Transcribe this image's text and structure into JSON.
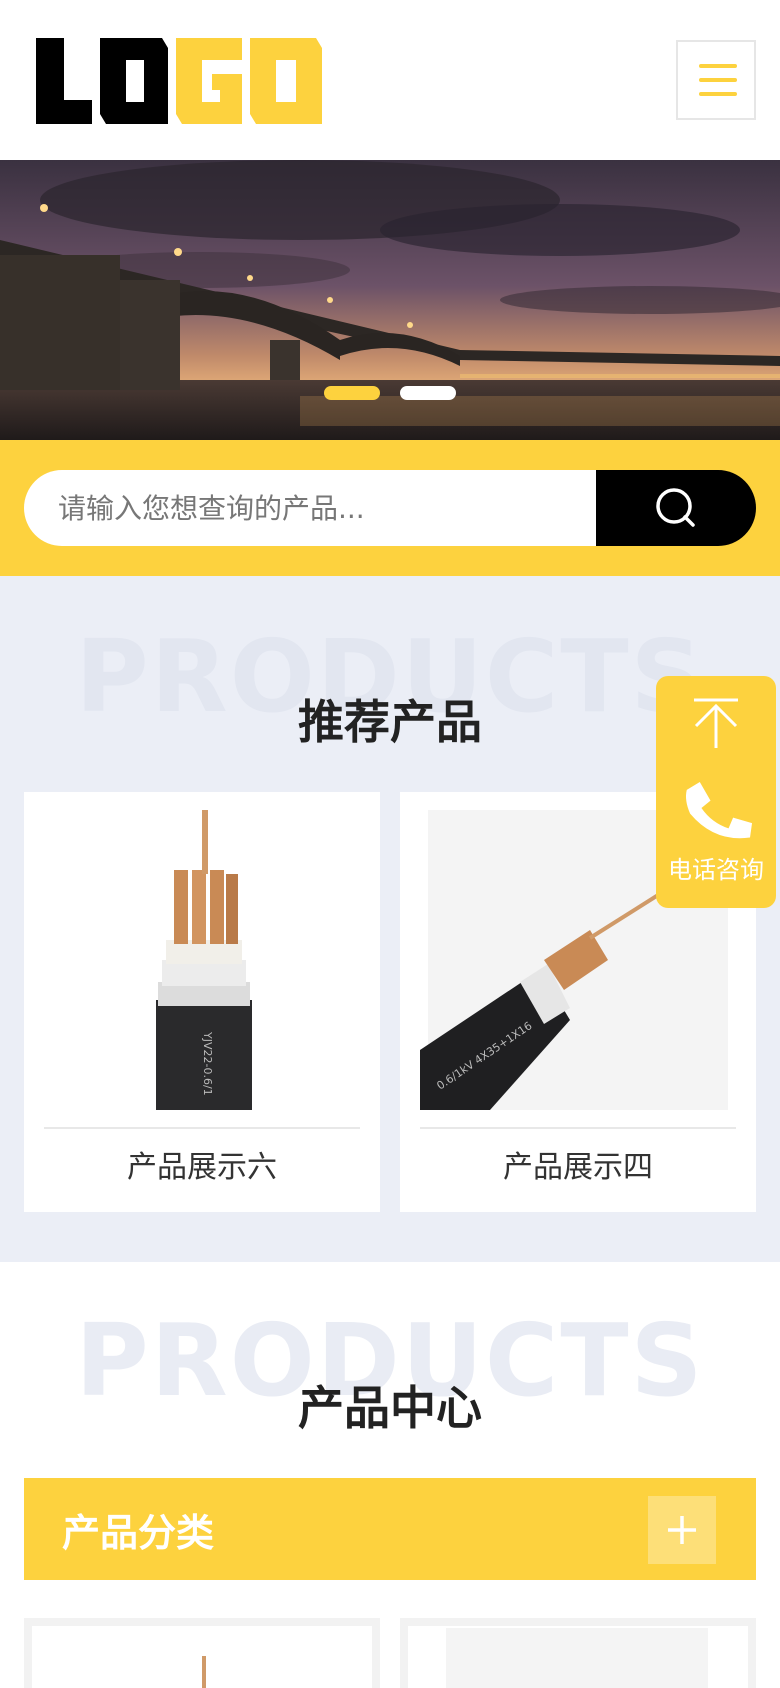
{
  "header": {
    "logo_text_dark": "LO",
    "logo_text_yellow": "GO",
    "menu_icon": "hamburger-icon"
  },
  "banner": {
    "slides": 2,
    "active_slide": 1
  },
  "search": {
    "placeholder": "请输入您想查询的产品...",
    "button_icon": "search-icon"
  },
  "recommended": {
    "bg_word": "PRODUCTS",
    "title": "推荐产品",
    "items": [
      {
        "label": "产品展示六"
      },
      {
        "label": "产品展示四"
      }
    ]
  },
  "float_bar": {
    "top_icon": "arrow-up-icon",
    "phone_icon": "phone-icon",
    "phone_label": "电话咨询"
  },
  "product_center": {
    "bg_word": "PRODUCTS",
    "title": "产品中心",
    "category_title": "产品分类",
    "category_toggle": "+"
  },
  "colors": {
    "accent": "#fdd23e",
    "section_bg": "#ebeef6",
    "dark": "#000000"
  }
}
